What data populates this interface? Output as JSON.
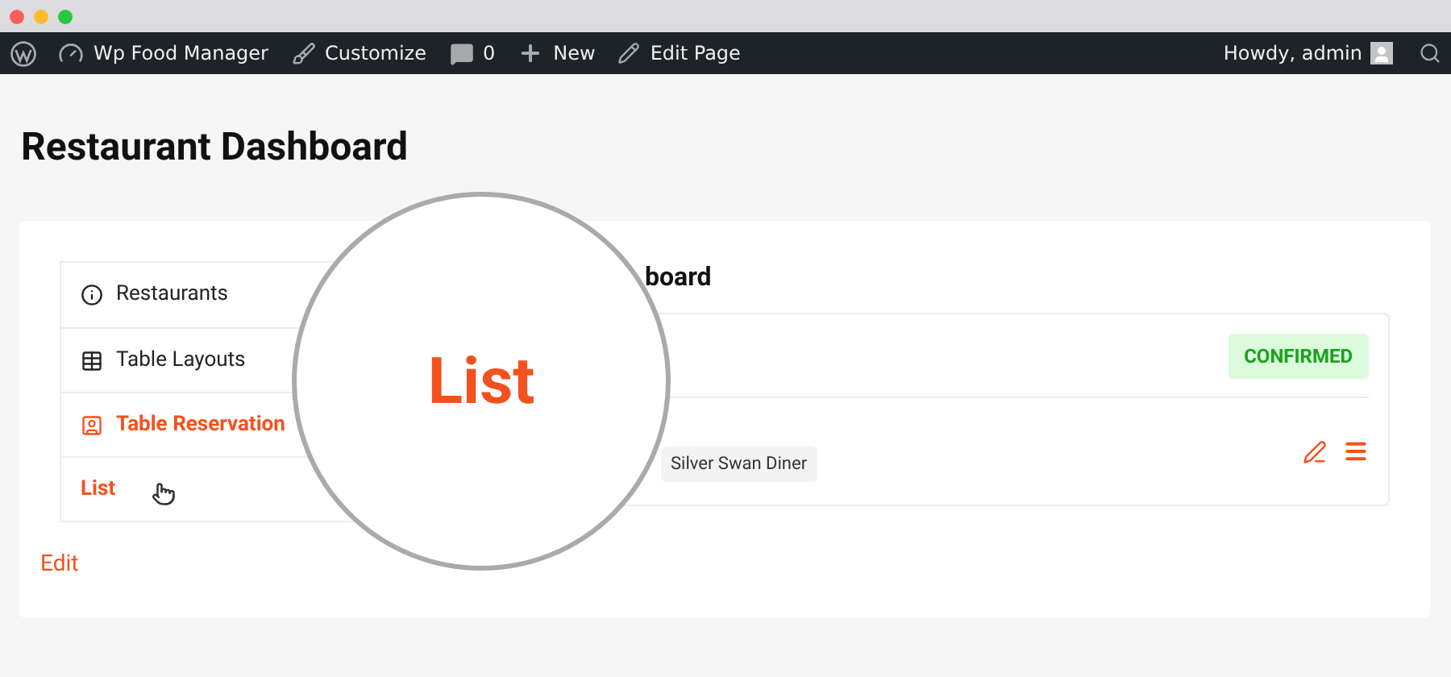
{
  "admin_bar": {
    "items": [
      {
        "kind": "site",
        "label": "Wp Food Manager"
      },
      {
        "kind": "customize",
        "label": "Customize"
      },
      {
        "kind": "comments",
        "label": "0"
      },
      {
        "kind": "new",
        "label": "New"
      },
      {
        "kind": "edit",
        "label": "Edit Page"
      }
    ],
    "greeting": "Howdy, admin"
  },
  "page_title": "Restaurant Dashboard",
  "sidebar": {
    "items": [
      {
        "kind": "info",
        "label": "Restaurants",
        "selected": false
      },
      {
        "kind": "grid",
        "label": "Table Layouts",
        "selected": false
      },
      {
        "kind": "reservation",
        "label": "Table Reservation",
        "selected": true
      },
      {
        "kind": "sub",
        "label": "List",
        "selected": true
      }
    ],
    "edit_link": "Edit"
  },
  "main": {
    "heading": "board",
    "status": "CONFIRMED",
    "tag": "Silver Swan Diner"
  },
  "magnifier": {
    "text": "List"
  }
}
